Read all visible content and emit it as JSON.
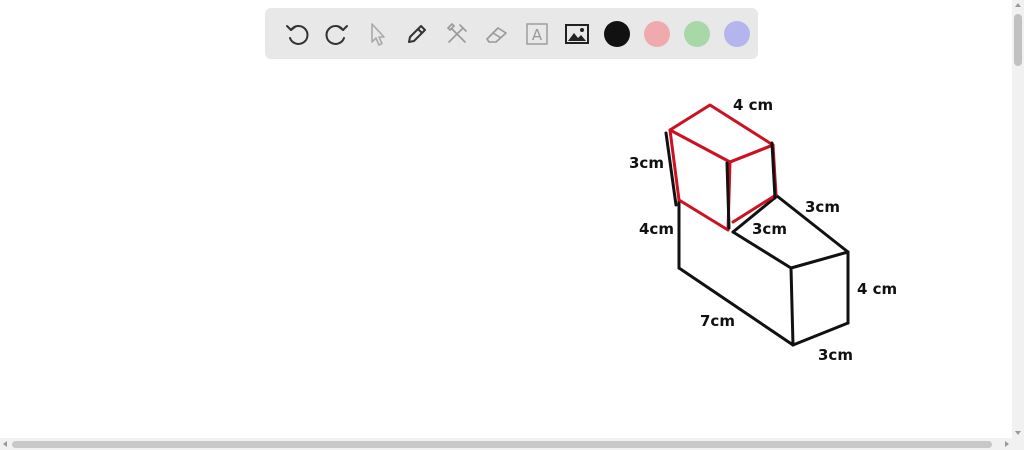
{
  "toolbar": {
    "tools": [
      "undo-icon",
      "redo-icon",
      "pointer-icon",
      "pen-icon",
      "tools-icon",
      "eraser-icon",
      "text-icon",
      "image-icon"
    ],
    "text_tool_glyph": "A",
    "colors": [
      {
        "name": "black",
        "hex": "#111111"
      },
      {
        "name": "red",
        "hex": "#f0a9ad"
      },
      {
        "name": "green",
        "hex": "#a8d8a8"
      },
      {
        "name": "blue",
        "hex": "#b4b4ee"
      }
    ],
    "selected_color": "black"
  },
  "drawing": {
    "labels": {
      "top_cube_width": "4 cm",
      "top_cube_height": "3cm",
      "top_cube_depth": "3cm",
      "base_left_height": "4cm",
      "base_top_depth": "3cm",
      "base_right_height": "4 cm",
      "base_length": "7cm",
      "base_bottom_depth": "3cm"
    },
    "stroke_colors": {
      "ink": "#111111",
      "highlight": "#cc1122"
    }
  }
}
